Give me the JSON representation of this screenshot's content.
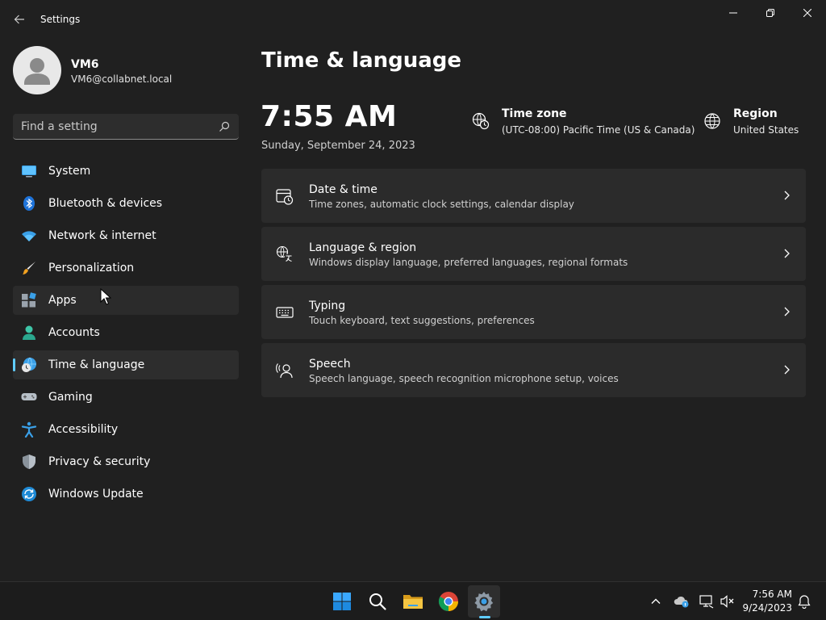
{
  "window": {
    "title": "Settings",
    "controls": {
      "minimize": "minimize",
      "maximize": "restore",
      "close": "close"
    }
  },
  "profile": {
    "name": "VM6",
    "email": "VM6@collabnet.local"
  },
  "search": {
    "placeholder": "Find a setting"
  },
  "sidebar": {
    "items": [
      {
        "label": "System",
        "icon": "system-icon"
      },
      {
        "label": "Bluetooth & devices",
        "icon": "bluetooth-icon"
      },
      {
        "label": "Network & internet",
        "icon": "wifi-icon"
      },
      {
        "label": "Personalization",
        "icon": "brush-icon"
      },
      {
        "label": "Apps",
        "icon": "apps-icon"
      },
      {
        "label": "Accounts",
        "icon": "accounts-icon"
      },
      {
        "label": "Time & language",
        "icon": "time-language-icon",
        "selected": true
      },
      {
        "label": "Gaming",
        "icon": "gamepad-icon"
      },
      {
        "label": "Accessibility",
        "icon": "accessibility-icon"
      },
      {
        "label": "Privacy & security",
        "icon": "shield-icon"
      },
      {
        "label": "Windows Update",
        "icon": "update-icon"
      }
    ]
  },
  "main": {
    "title": "Time & language",
    "clock": {
      "time": "7:55 AM",
      "date": "Sunday, September 24, 2023"
    },
    "time_zone": {
      "title": "Time zone",
      "value": "(UTC-08:00) Pacific Time (US & Canada)"
    },
    "region": {
      "title": "Region",
      "value": "United States"
    },
    "cards": [
      {
        "title": "Date & time",
        "description": "Time zones, automatic clock settings, calendar display",
        "icon": "calendar-clock-icon"
      },
      {
        "title": "Language & region",
        "description": "Windows display language, preferred languages, regional formats",
        "icon": "language-icon"
      },
      {
        "title": "Typing",
        "description": "Touch keyboard, text suggestions, preferences",
        "icon": "keyboard-icon"
      },
      {
        "title": "Speech",
        "description": "Speech language, speech recognition microphone setup, voices",
        "icon": "speech-icon"
      }
    ]
  },
  "taskbar": {
    "apps": [
      "start-icon",
      "search-icon",
      "file-explorer-icon",
      "chrome-icon",
      "settings-icon"
    ],
    "tray": {
      "time": "7:56 AM",
      "date": "9/24/2023"
    }
  },
  "colors": {
    "background": "#202020",
    "card": "#2b2b2b",
    "accent": "#60cdff",
    "taskbar": "#1c1c1c"
  }
}
